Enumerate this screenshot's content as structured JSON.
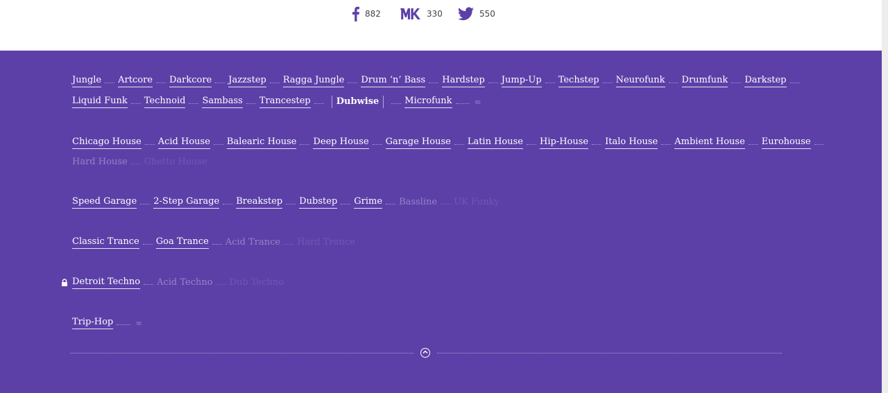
{
  "share": {
    "facebook": {
      "count": "882",
      "icon": "facebook-icon"
    },
    "vk": {
      "count": "330",
      "icon": "vk-icon"
    },
    "twitter": {
      "count": "550",
      "icon": "twitter-icon"
    }
  },
  "groups": {
    "dnb": {
      "row1": [
        "Jungle",
        "Artcore",
        "Darkcore",
        "Jazzstep",
        "Ragga Jungle",
        "Drum ‘n’ Bass",
        "Hardstep",
        "Jump-Up",
        "Techstep",
        "Neurofunk",
        "Drumfunk",
        "Darkstep"
      ],
      "row2_before": [
        "Liquid Funk",
        "Technoid",
        "Sambass",
        "Trancestep"
      ],
      "active": "Dubwise",
      "row2_after": [
        "Microfunk"
      ],
      "more": "∞"
    },
    "house": {
      "row1": [
        "Chicago House",
        "Acid House",
        "Balearic House",
        "Deep House",
        "Garage House",
        "Latin House",
        "Hip-House",
        "Italo House",
        "Ambient House",
        "Eurohouse"
      ],
      "row2_dim": [
        "Hard House",
        "Ghetto House"
      ]
    },
    "ukg": {
      "links": [
        "Speed Garage",
        "2-Step Garage",
        "Breakstep",
        "Dubstep",
        "Grime"
      ],
      "dim": [
        "Bassline",
        "UK Funky"
      ]
    },
    "trance": {
      "links": [
        "Classic Trance",
        "Goa Trance"
      ],
      "dim": [
        "Acid Trance",
        "Hard Trance"
      ]
    },
    "techno": {
      "links": [
        "Detroit Techno"
      ],
      "dim": [
        "Acid Techno",
        "Dub Techno"
      ],
      "lock_icon": "lock-icon"
    },
    "triphop": {
      "links": [
        "Trip-Hop"
      ],
      "more": "∞"
    }
  },
  "footer": {
    "scroll_top_icon": "chevron-up-circle-icon"
  },
  "colors": {
    "background": "#5c40a8",
    "topbar": "#ffffff",
    "text": "#ffffff"
  }
}
